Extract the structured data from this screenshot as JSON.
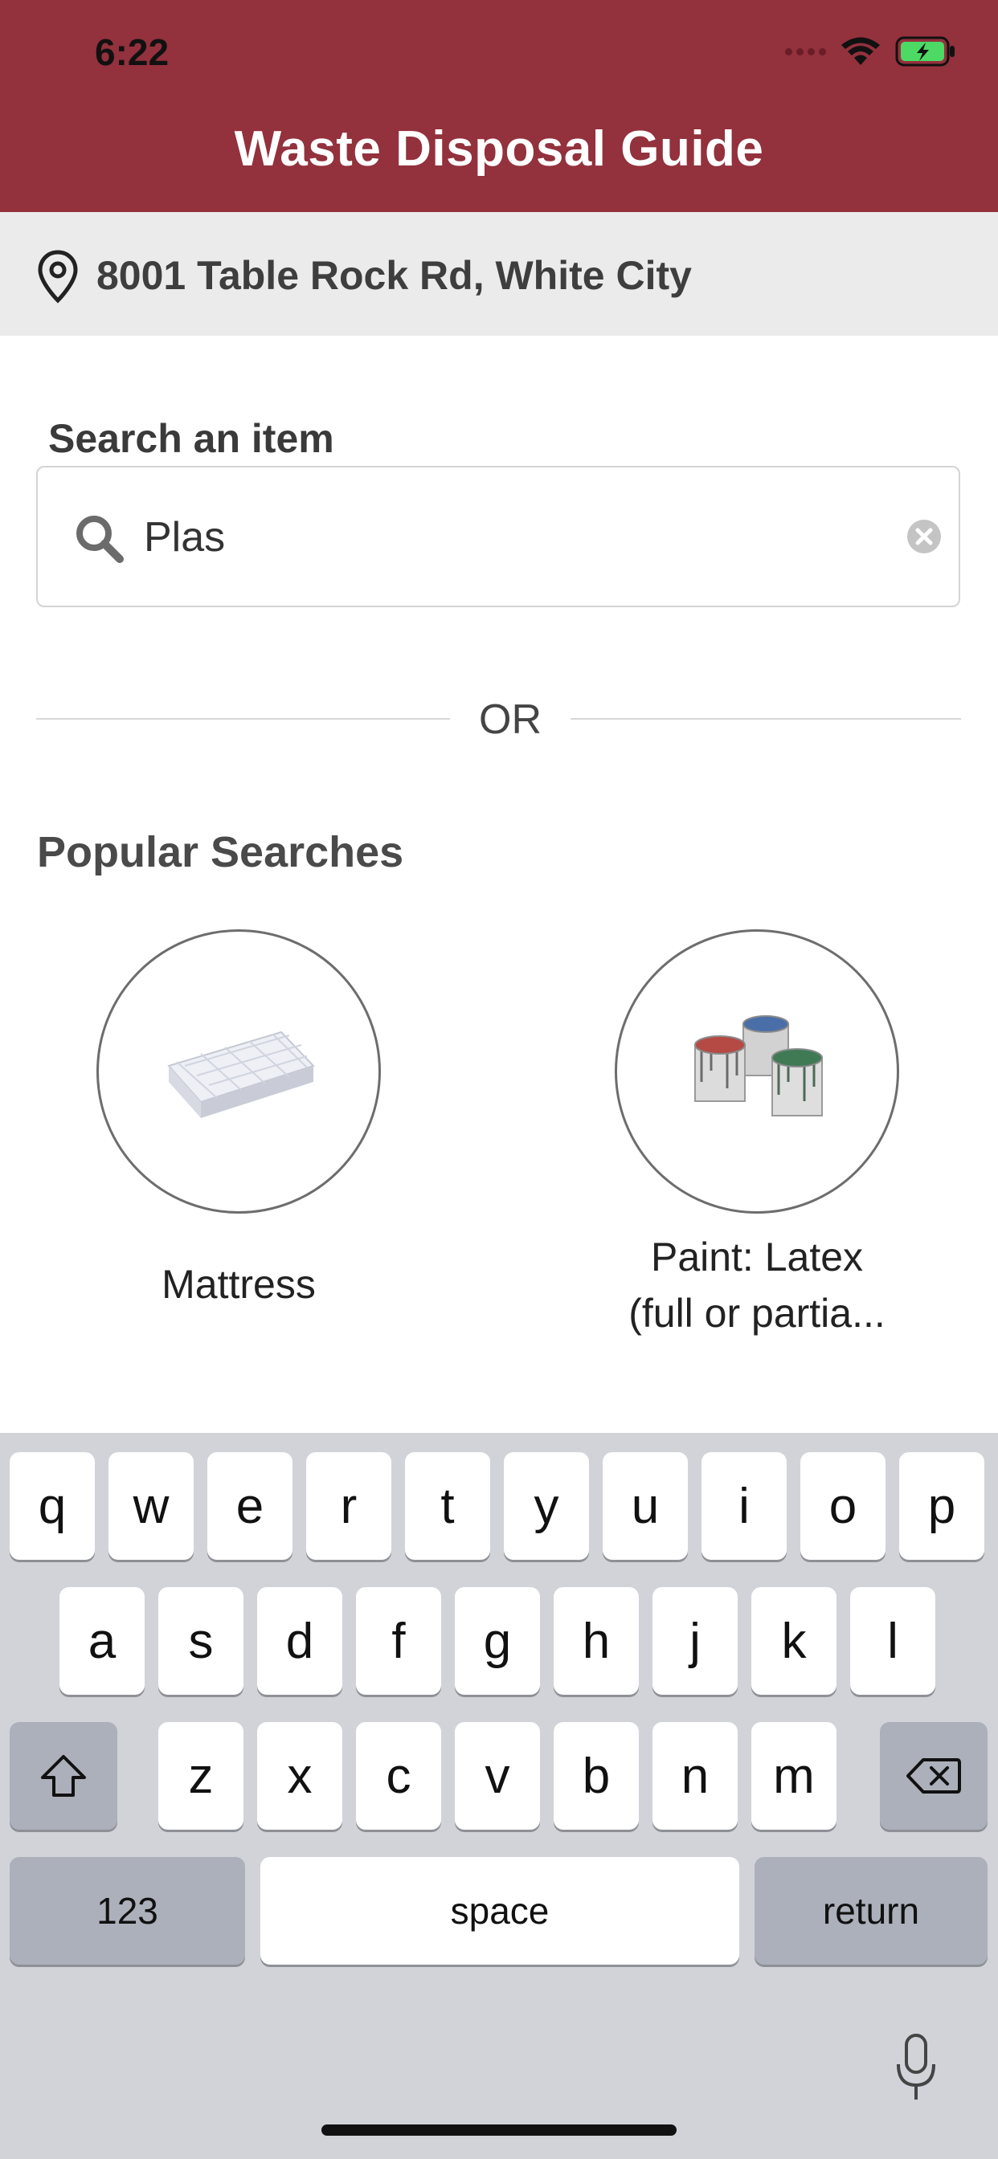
{
  "status_bar": {
    "time": "6:22"
  },
  "header": {
    "title": "Waste Disposal Guide"
  },
  "address": {
    "text": "8001 Table Rock Rd, White City"
  },
  "search": {
    "label": "Search an item",
    "value": "Plas"
  },
  "divider": {
    "text": "OR"
  },
  "popular": {
    "title": "Popular Searches",
    "items": [
      {
        "label": "Mattress"
      },
      {
        "label_line1": "Paint: Latex",
        "label_line2": "(full or partia..."
      }
    ]
  },
  "keyboard": {
    "row1": [
      "q",
      "w",
      "e",
      "r",
      "t",
      "y",
      "u",
      "i",
      "o",
      "p"
    ],
    "row2": [
      "a",
      "s",
      "d",
      "f",
      "g",
      "h",
      "j",
      "k",
      "l"
    ],
    "row3": [
      "z",
      "x",
      "c",
      "v",
      "b",
      "n",
      "m"
    ],
    "numbers_label": "123",
    "space_label": "space",
    "return_label": "return"
  },
  "colors": {
    "header": "#93313d",
    "keyboard_bg": "#d1d3d9",
    "battery": "#4cd964"
  },
  "icons": [
    "location-pin-icon",
    "search-icon",
    "clear-icon",
    "wifi-icon",
    "battery-icon",
    "shift-icon",
    "backspace-icon",
    "microphone-icon"
  ]
}
